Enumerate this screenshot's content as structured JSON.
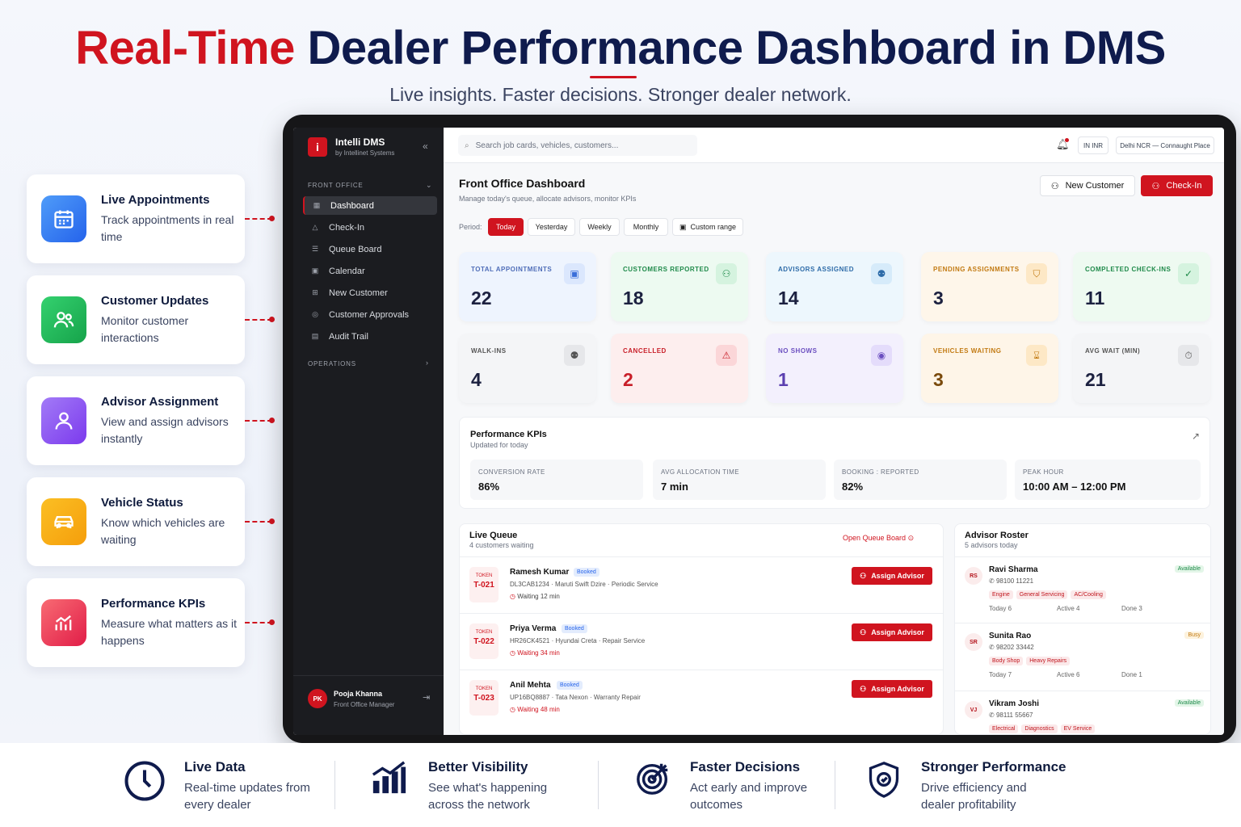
{
  "hero": {
    "title_red": "Real-Time",
    "title_rest": " Dealer Performance Dashboard in DMS",
    "subtitle": "Live insights. Faster decisions. Stronger dealer network."
  },
  "features": [
    {
      "title": "Live Appointments",
      "desc": "Track appointments in real time",
      "icon": "calendar-icon",
      "color": "#3b82f6"
    },
    {
      "title": "Customer Updates",
      "desc": "Monitor customer interactions",
      "icon": "users-icon",
      "color": "#22c55e"
    },
    {
      "title": "Advisor Assignment",
      "desc": "View and assign advisors instantly",
      "icon": "user-icon",
      "color": "#8b5cf6"
    },
    {
      "title": "Vehicle Status",
      "desc": "Know which vehicles are waiting",
      "icon": "car-icon",
      "color": "#f59e0b"
    },
    {
      "title": "Performance KPIs",
      "desc": "Measure what matters as it happens",
      "icon": "bar-chart-icon",
      "color": "#ef4444"
    }
  ],
  "app": {
    "brand": "Intelli DMS",
    "brand_sub": "by Intellinet Systems",
    "logo_letter": "i",
    "section_front": "FRONT OFFICE",
    "section_ops": "OPERATIONS",
    "nav": [
      "Dashboard",
      "Check-In",
      "Queue Board",
      "Calendar",
      "New Customer",
      "Customer Approvals",
      "Audit Trail"
    ],
    "user": {
      "initials": "PK",
      "name": "Pooja Khanna",
      "role": "Front Office Manager"
    },
    "search_placeholder": "Search job cards, vehicles, customers...",
    "currency": "IN INR",
    "location": "Delhi NCR — Connaught Place",
    "page_title": "Front Office Dashboard",
    "page_sub": "Manage today's queue, allocate advisors, monitor KPIs",
    "new_customer": "New Customer",
    "check_in": "Check-In",
    "period_label": "Period:",
    "periods": [
      "Today",
      "Yesterday",
      "Weekly",
      "Monthly",
      "Custom range"
    ],
    "kpis": [
      {
        "label": "TOTAL APPOINTMENTS",
        "value": "22"
      },
      {
        "label": "CUSTOMERS REPORTED",
        "value": "18"
      },
      {
        "label": "ADVISORS ASSIGNED",
        "value": "14"
      },
      {
        "label": "PENDING ASSIGNMENTS",
        "value": "3"
      },
      {
        "label": "COMPLETED CHECK-INS",
        "value": "11"
      },
      {
        "label": "WALK-INS",
        "value": "4"
      },
      {
        "label": "CANCELLED",
        "value": "2"
      },
      {
        "label": "NO SHOWS",
        "value": "1"
      },
      {
        "label": "VEHICLES WAITING",
        "value": "3"
      },
      {
        "label": "AVG WAIT (MIN)",
        "value": "21"
      }
    ],
    "perf": {
      "title": "Performance KPIs",
      "sub": "Updated for today",
      "metrics": [
        {
          "label": "CONVERSION RATE",
          "value": "86%"
        },
        {
          "label": "AVG ALLOCATION TIME",
          "value": "7 min"
        },
        {
          "label": "BOOKING : REPORTED",
          "value": "82%"
        },
        {
          "label": "PEAK HOUR",
          "value": "10:00 AM – 12:00 PM"
        }
      ]
    },
    "queue": {
      "title": "Live Queue",
      "sub": "4 customers waiting",
      "open": "Open Queue Board",
      "token_label": "TOKEN",
      "assign": "Assign Advisor",
      "rows": [
        {
          "token": "T-021",
          "name": "Ramesh Kumar",
          "badge": "Booked",
          "detail": "DL3CAB1234 · Maruti Swift Dzire · Periodic Service",
          "wait": "Waiting 12 min"
        },
        {
          "token": "T-022",
          "name": "Priya Verma",
          "badge": "Booked",
          "detail": "HR26CK4521 · Hyundai Creta · Repair Service",
          "wait": "Waiting 34 min"
        },
        {
          "token": "T-023",
          "name": "Anil Mehta",
          "badge": "Booked",
          "detail": "UP16BQ8887 · Tata Nexon · Warranty Repair",
          "wait": "Waiting 48 min"
        }
      ]
    },
    "roster": {
      "title": "Advisor Roster",
      "sub": "5 advisors today",
      "advisors": [
        {
          "initials": "RS",
          "name": "Ravi Sharma",
          "phone": "98100 11221",
          "status": "Available",
          "tags": [
            "Engine",
            "General Servicing",
            "AC/Cooling"
          ],
          "today": "Today 6",
          "active": "Active 4",
          "done": "Done 3"
        },
        {
          "initials": "SR",
          "name": "Sunita Rao",
          "phone": "98202 33442",
          "status": "Busy",
          "tags": [
            "Body Shop",
            "Heavy Repairs"
          ],
          "today": "Today 7",
          "active": "Active 6",
          "done": "Done 1"
        },
        {
          "initials": "VJ",
          "name": "Vikram Joshi",
          "phone": "98111 55667",
          "status": "Available",
          "tags": [
            "Electrical",
            "Diagnostics",
            "EV Service"
          ],
          "today": "",
          "active": "",
          "done": ""
        }
      ]
    }
  },
  "benefits": [
    {
      "title": "Live Data",
      "desc": "Real-time updates from every dealer",
      "icon": "clock-icon"
    },
    {
      "title": "Better Visibility",
      "desc": "See what's happening across the network",
      "icon": "growth-chart-icon"
    },
    {
      "title": "Faster Decisions",
      "desc": "Act early and improve outcomes",
      "icon": "target-icon"
    },
    {
      "title": "Stronger Performance",
      "desc": "Drive efficiency and dealer profitability",
      "icon": "shield-check-icon"
    }
  ]
}
